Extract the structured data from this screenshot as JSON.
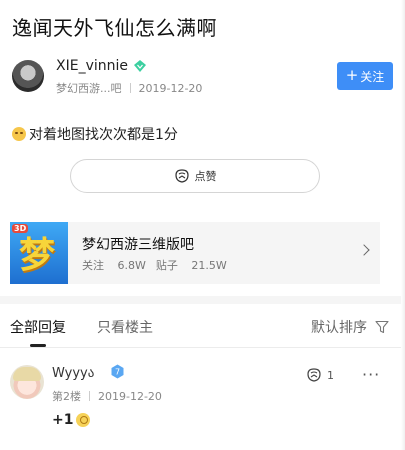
{
  "post": {
    "title": "逸闻天外飞仙怎么满啊",
    "author": {
      "name": "XIE_vinnie",
      "badge_icon": "diamond-badge-icon",
      "forum_short": "梦幻西游...吧",
      "date": "2019-12-20"
    },
    "follow_label": "关注",
    "content": "对着地图找次次都是1分",
    "like_label": "点赞"
  },
  "forum": {
    "name": "梦幻西游三维版吧",
    "logo_glyph": "梦",
    "logo_tag": "3D",
    "followers_label": "关注",
    "followers": "6.8W",
    "posts_label": "贴子",
    "posts": "21.5W"
  },
  "tabs": {
    "all": "全部回复",
    "owner_only": "只看楼主",
    "sort": "默认排序"
  },
  "reply": {
    "user": "Wyyyა",
    "level": "7",
    "floor": "第2楼",
    "date": "2019-12-20",
    "likes": "1",
    "more": "···",
    "text": "+1"
  },
  "colors": {
    "accent": "#3e8ef7",
    "badge_green": "#3ccfa0",
    "badge_blue": "#5aa7f2"
  }
}
